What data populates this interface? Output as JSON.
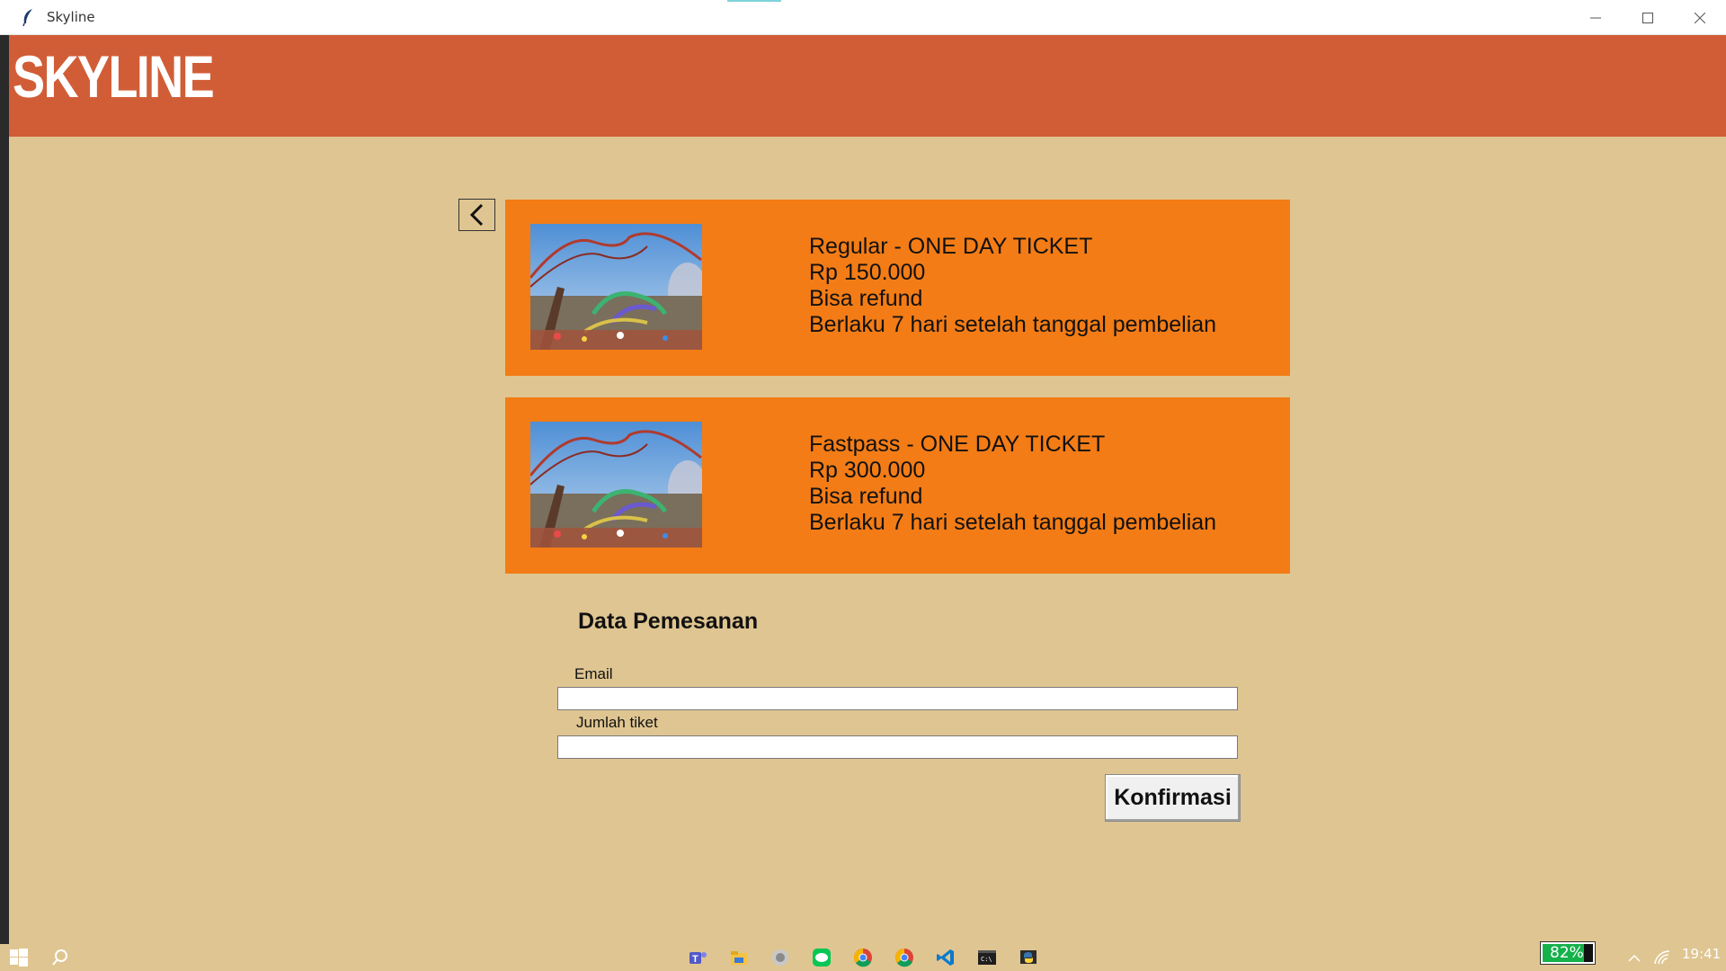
{
  "window": {
    "title": "Skyline",
    "minimize_icon": "minimize-icon",
    "maximize_icon": "maximize-icon",
    "close_icon": "close-icon"
  },
  "header": {
    "logo_text": "SKYLINE",
    "background": "#d15d37"
  },
  "back_button": {
    "icon": "chevron-left-icon"
  },
  "tickets": [
    {
      "name": "Regular - ONE DAY TICKET",
      "price": "Rp 150.000",
      "refund": "Bisa refund",
      "validity": "Berlaku 7 hari setelah tanggal pembelian"
    },
    {
      "name": "Fastpass - ONE DAY TICKET",
      "price": "Rp 300.000",
      "refund": "Bisa refund",
      "validity": "Berlaku 7 hari setelah tanggal pembelian"
    }
  ],
  "form": {
    "title": "Data Pemesanan",
    "email_label": "Email",
    "email_value": "",
    "quantity_label": "Jumlah tiket",
    "quantity_value": "",
    "confirm_label": "Konfirmasi"
  },
  "taskbar": {
    "battery": "82%",
    "time": "19:41",
    "apps": [
      "teams-icon",
      "file-explorer-icon",
      "app-icon",
      "line-icon",
      "chrome-icon",
      "chrome-icon",
      "vscode-icon",
      "terminal-icon",
      "python-icon"
    ]
  },
  "colors": {
    "page_background": "#dfc591",
    "card_background": "#f37c16",
    "header_background": "#d15d37"
  }
}
